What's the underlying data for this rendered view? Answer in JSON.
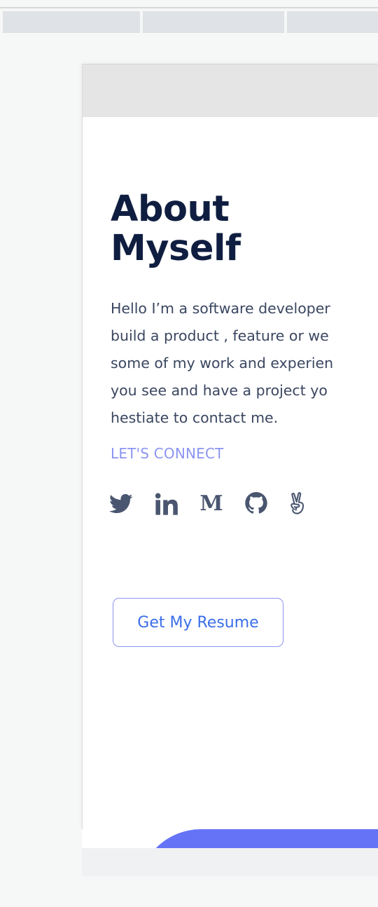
{
  "colors": {
    "title": "#0f1e40",
    "body_text": "#3a4660",
    "accent": "#8b95f2",
    "button_text": "#3a6ee8",
    "blob": "#6573f6",
    "icon": "#4a5670"
  },
  "about": {
    "title": "About\nMyself",
    "bio": "Hello I’m a software developer\nbuild a product , feature or we\nsome of my work and experien\nyou see and have a project yo\nhestiate to contact me.",
    "connect_label": "LET'S CONNECT",
    "social_icons": [
      "twitter-icon",
      "linkedin-icon",
      "medium-icon",
      "github-icon",
      "angellist-icon"
    ],
    "medium_glyph": "M",
    "resume_button": "Get My Resume"
  }
}
